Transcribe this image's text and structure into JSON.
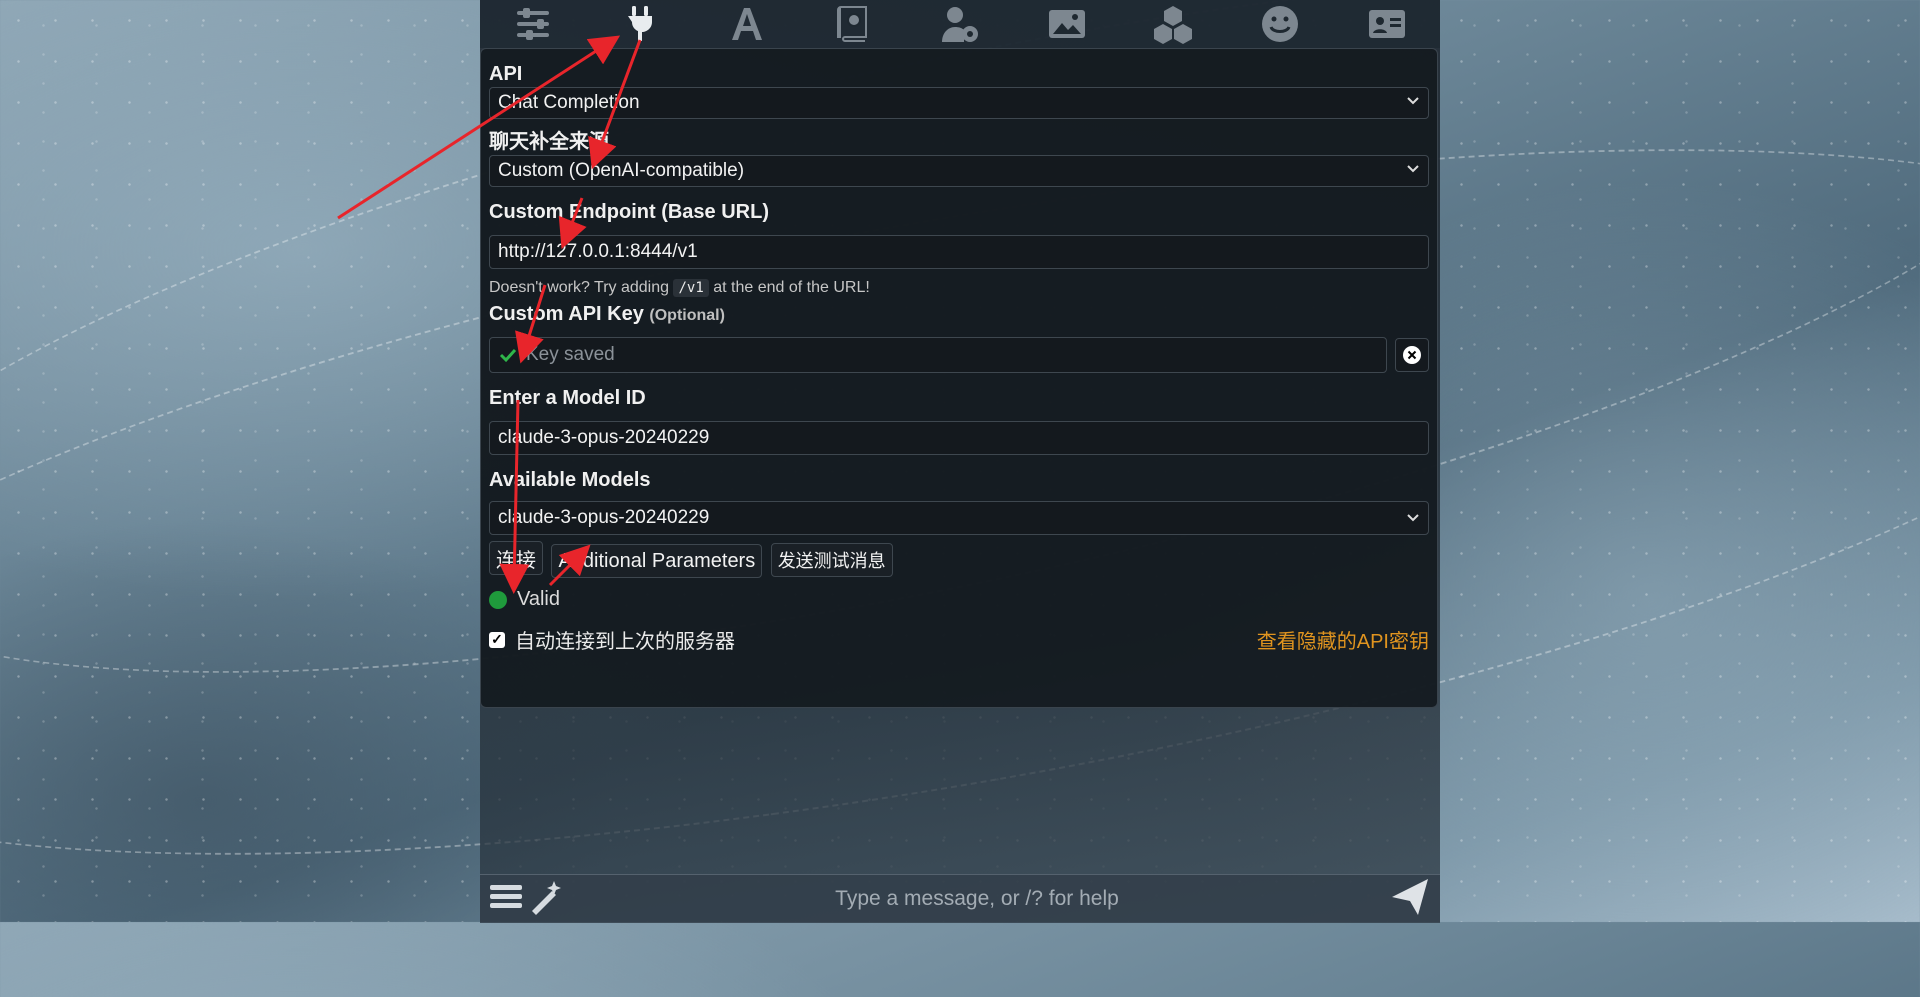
{
  "background": {
    "theme": "starry-sky"
  },
  "topbar": {
    "icons": [
      {
        "name": "sliders-icon"
      },
      {
        "name": "plug-icon",
        "active": true
      },
      {
        "name": "font-icon"
      },
      {
        "name": "book-globe-icon"
      },
      {
        "name": "user-gear-icon"
      },
      {
        "name": "image-icon"
      },
      {
        "name": "cubes-icon"
      },
      {
        "name": "smile-icon"
      },
      {
        "name": "id-card-icon"
      }
    ]
  },
  "api": {
    "label": "API",
    "value": "Chat Completion"
  },
  "source": {
    "label": "聊天补全来源",
    "value": "Custom (OpenAI-compatible)"
  },
  "endpoint": {
    "label": "Custom Endpoint (Base URL)",
    "value": "http://127.0.0.1:8444/v1",
    "hint_prefix": "Doesn't work? Try adding",
    "hint_code": "/v1",
    "hint_suffix": "at the end of the URL!"
  },
  "api_key": {
    "label": "Custom API Key",
    "optional": "(Optional)",
    "placeholder": "Key saved"
  },
  "model_id": {
    "label": "Enter a Model ID",
    "value": "claude-3-opus-20240229"
  },
  "available_models": {
    "label": "Available Models",
    "value": "claude-3-opus-20240229"
  },
  "buttons": {
    "connect": "连接",
    "additional": "Additional Parameters",
    "test": "发送测试消息"
  },
  "status": {
    "text": "Valid",
    "color": "#1f9a3c"
  },
  "auto_connect": {
    "label": "自动连接到上次的服务器",
    "checked": true
  },
  "view_hidden_keys": "查看隐藏的API密钥",
  "chat": {
    "placeholder": "Type a message, or /? for help"
  },
  "colors": {
    "accent_link": "#e0941f",
    "annotation_arrow": "#e8252b"
  }
}
